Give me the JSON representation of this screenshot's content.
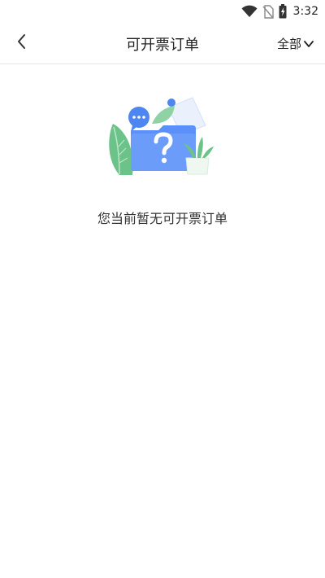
{
  "status_bar": {
    "time": "3:32",
    "icons": [
      "wifi-icon",
      "no-sim-icon",
      "battery-charging-icon"
    ]
  },
  "header": {
    "back_icon": "chevron-left-icon",
    "title": "可开票订单",
    "filter_label": "全部",
    "filter_icon": "chevron-down-icon"
  },
  "empty_state": {
    "illustration": "question-folder-illustration",
    "message": "您当前暂无可开票订单"
  },
  "colors": {
    "accent_blue": "#5b8ff9",
    "leaf_green": "#6cc38a",
    "divider": "#e6e6e6"
  }
}
